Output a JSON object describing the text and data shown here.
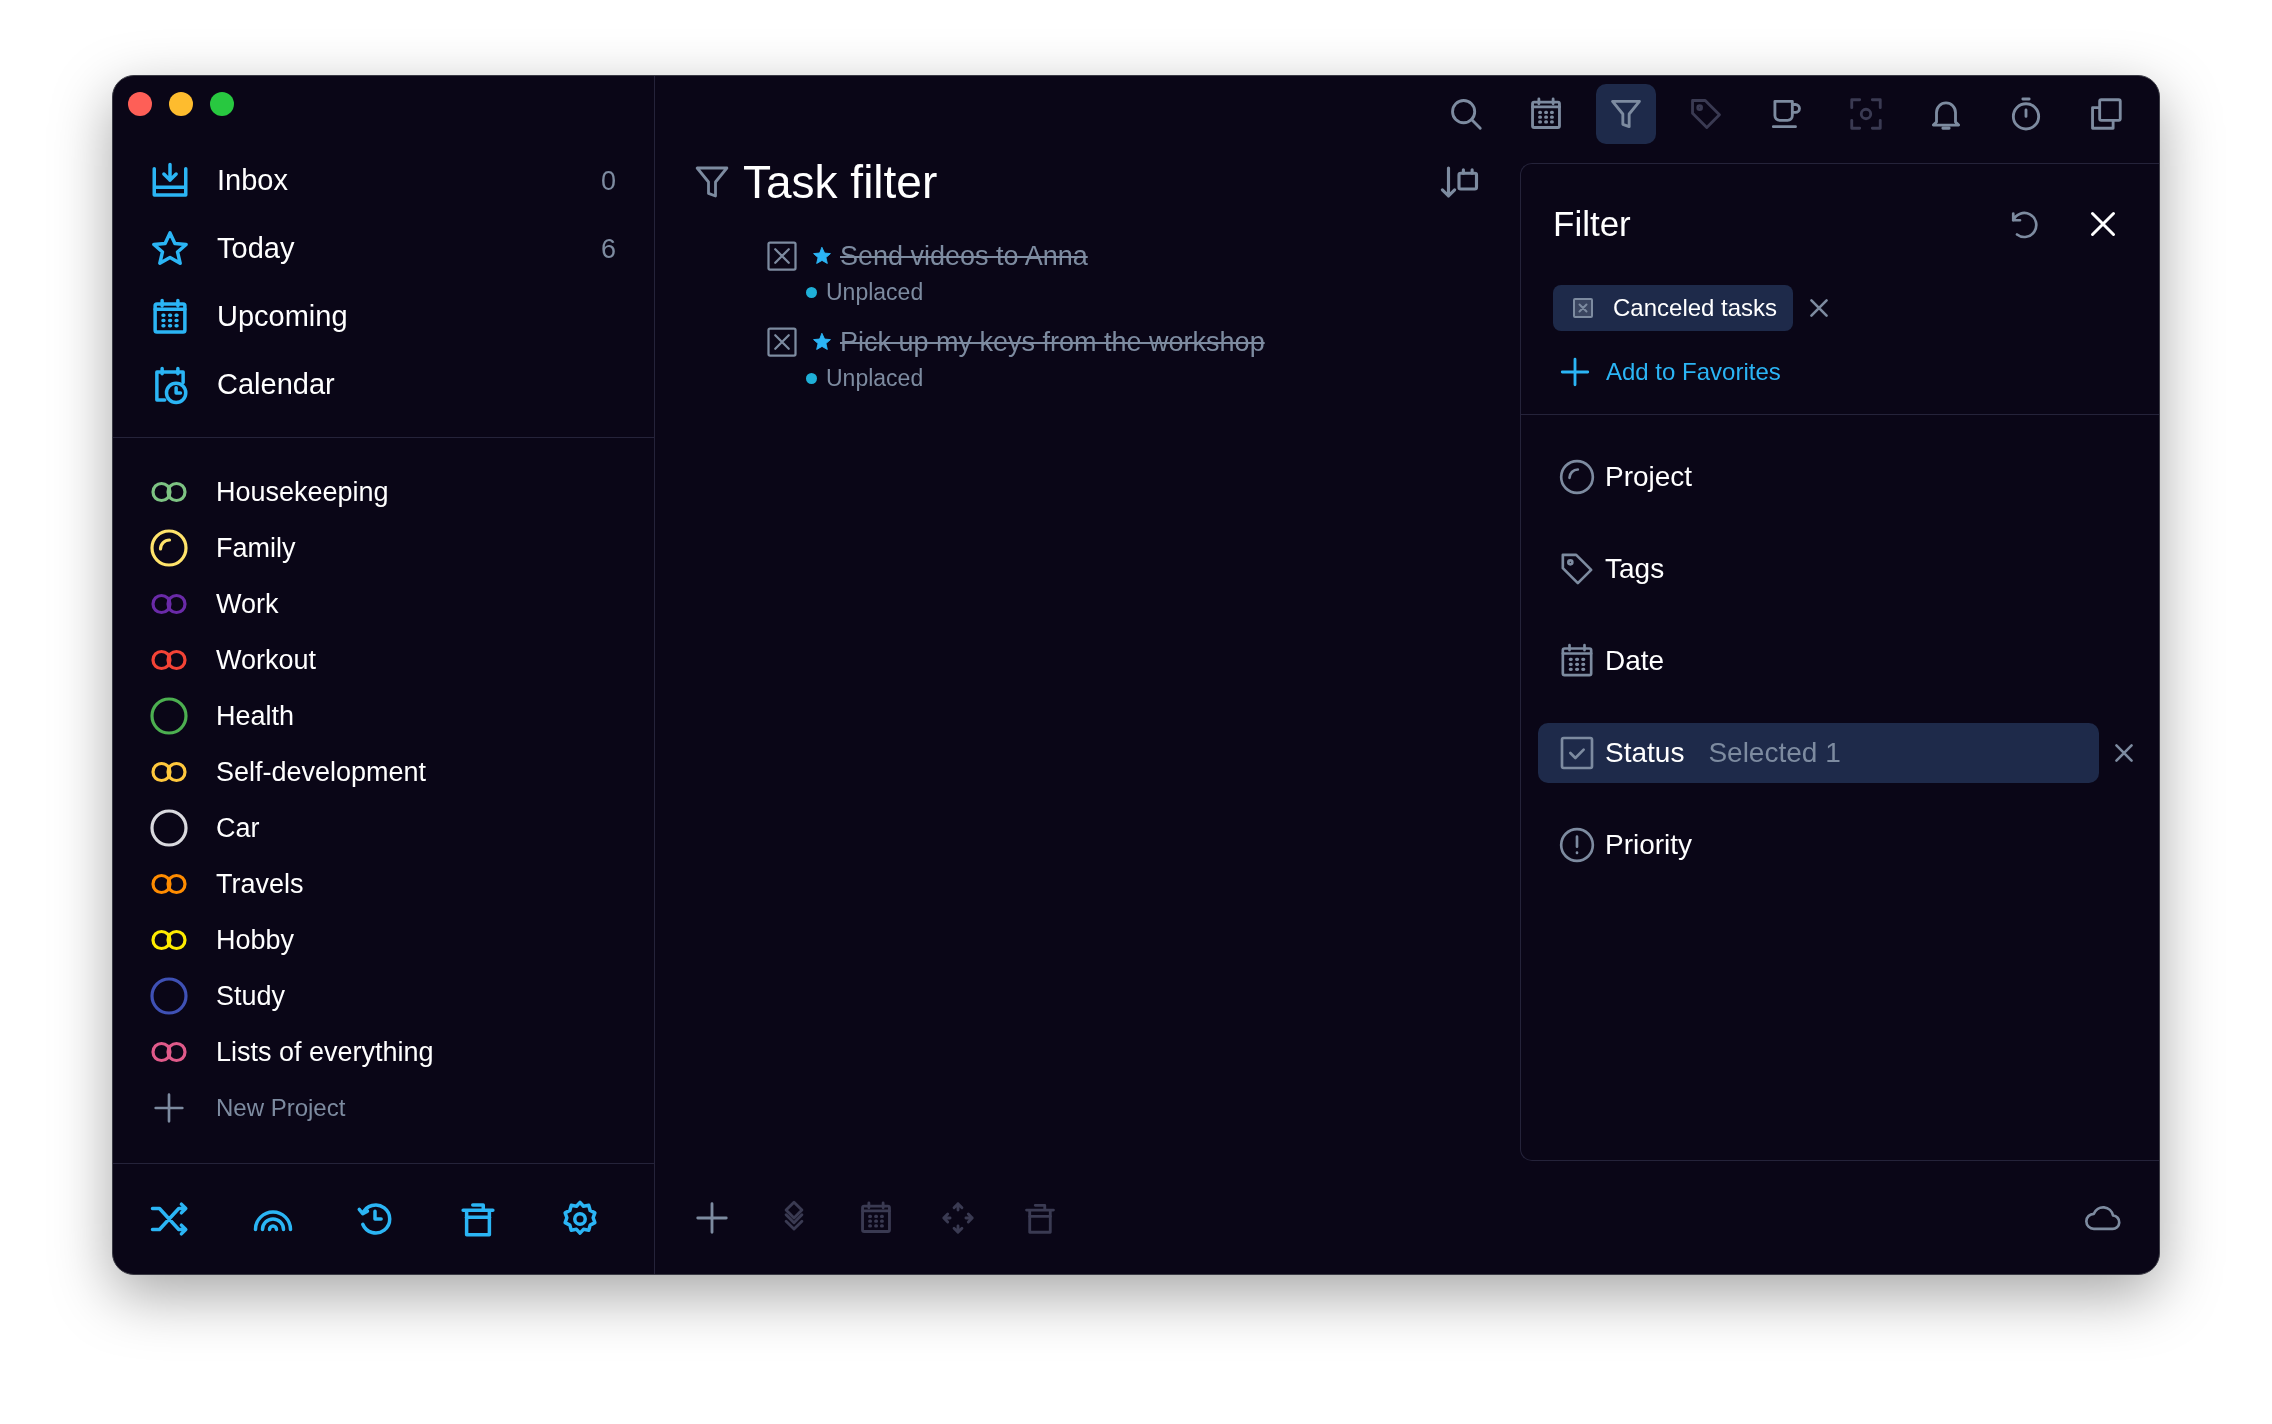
{
  "sidebar": {
    "nav": [
      {
        "label": "Inbox",
        "count": "0"
      },
      {
        "label": "Today",
        "count": "6"
      },
      {
        "label": "Upcoming"
      },
      {
        "label": "Calendar"
      }
    ],
    "projects": [
      {
        "name": "Housekeeping",
        "color": "#7dc383",
        "kind": "rings"
      },
      {
        "name": "Family",
        "color": "#ffe36b",
        "kind": "arc"
      },
      {
        "name": "Work",
        "color": "#6a2aa8",
        "kind": "rings"
      },
      {
        "name": "Workout",
        "color": "#f44336",
        "kind": "rings"
      },
      {
        "name": "Health",
        "color": "#4caf50",
        "kind": "ring"
      },
      {
        "name": "Self-development",
        "color": "#ffc83d",
        "kind": "rings"
      },
      {
        "name": "Car",
        "color": "#d9d9de",
        "kind": "ring"
      },
      {
        "name": "Travels",
        "color": "#ff8c00",
        "kind": "rings"
      },
      {
        "name": "Hobby",
        "color": "#ffeb00",
        "kind": "rings"
      },
      {
        "name": "Study",
        "color": "#3f51b5",
        "kind": "ring"
      },
      {
        "name": "Lists of everything",
        "color": "#e05a8a",
        "kind": "rings"
      }
    ],
    "new_project": "New Project"
  },
  "toolbar": [
    {
      "selected": false,
      "disabled": false
    },
    {
      "selected": false,
      "disabled": false
    },
    {
      "selected": true,
      "disabled": false
    },
    {
      "selected": false,
      "disabled": true
    },
    {
      "selected": false,
      "disabled": false
    },
    {
      "selected": false,
      "disabled": true
    },
    {
      "selected": false,
      "disabled": false
    },
    {
      "selected": false,
      "disabled": false
    },
    {
      "selected": false,
      "disabled": false
    }
  ],
  "main": {
    "title": "Task filter",
    "tasks": [
      {
        "title": "Send videos to Anna",
        "canceled": true,
        "starred": true,
        "project": "Unplaced"
      },
      {
        "title": "Pick up my keys from the workshop",
        "canceled": true,
        "starred": true,
        "project": "Unplaced"
      }
    ]
  },
  "filter": {
    "title": "Filter",
    "chips": [
      {
        "label": "Canceled tasks"
      }
    ],
    "add_favorites": "Add to Favorites",
    "criteria": [
      {
        "label": "Project",
        "selected": false
      },
      {
        "label": "Tags",
        "selected": false
      },
      {
        "label": "Date",
        "selected": false
      },
      {
        "label": "Status",
        "selected": true,
        "value": "Selected 1"
      },
      {
        "label": "Priority",
        "selected": false
      }
    ]
  }
}
